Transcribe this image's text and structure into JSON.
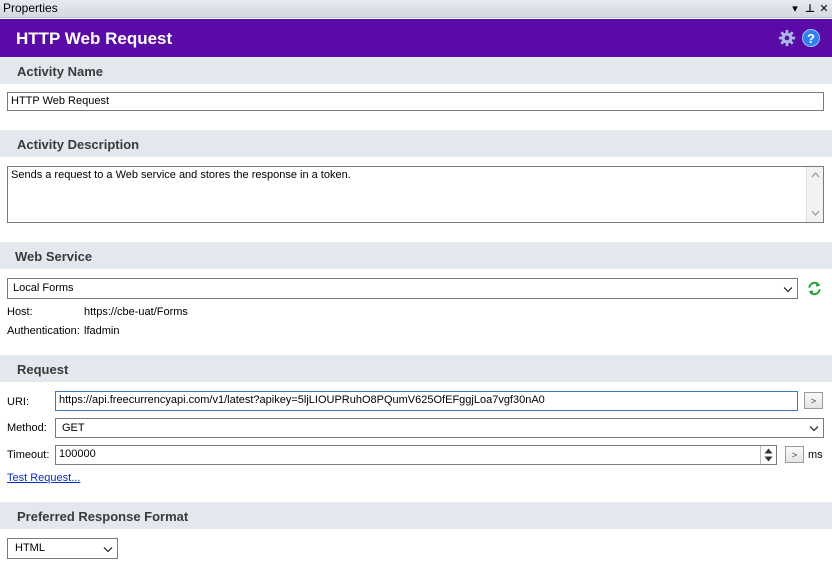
{
  "window": {
    "title": "Properties",
    "pin_glyph": "▾",
    "pushpin_glyph": "⊥",
    "close_glyph": "✕"
  },
  "header": {
    "title": "HTTP Web Request",
    "help_glyph": "?"
  },
  "activity_name": {
    "section_label": "Activity Name",
    "value": "HTTP Web Request"
  },
  "activity_description": {
    "section_label": "Activity Description",
    "value": "Sends a request to a Web service and stores the response in a token."
  },
  "web_service": {
    "section_label": "Web Service",
    "selected": "Local Forms",
    "host_label": "Host:",
    "host_value": "https://cbe-uat/Forms",
    "auth_label": "Authentication:",
    "auth_value": "lfadmin"
  },
  "request": {
    "section_label": "Request",
    "uri_label": "URI:",
    "uri_value": "https://api.freecurrencyapi.com/v1/latest?apikey=5ljLIOUPRuhO8PQumV625OfEFggjLoa7vgf30nA0",
    "uri_button": ">",
    "method_label": "Method:",
    "method_value": "GET",
    "timeout_label": "Timeout:",
    "timeout_value": "100000",
    "timeout_button": ">",
    "timeout_unit": "ms",
    "test_link": "Test Request..."
  },
  "response_format": {
    "section_label": "Preferred Response Format",
    "selected": "HTML"
  },
  "colors": {
    "header_bg": "#5a0aa6",
    "section_bg": "#e3e8ef",
    "link": "#0a2fc4",
    "refresh_green": "#2aa33a"
  }
}
